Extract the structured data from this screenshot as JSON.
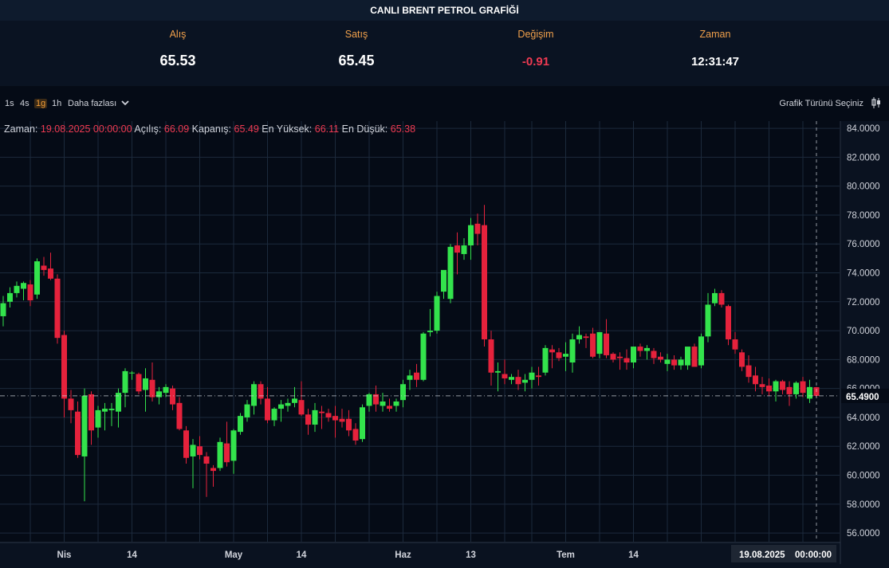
{
  "app": {
    "title": "CANLI BRENT PETROL GRAFİĞİ"
  },
  "quotes": {
    "bid_label": "Alış",
    "bid_value": "65.53",
    "ask_label": "Satış",
    "ask_value": "65.45",
    "change_label": "Değişim",
    "change_value": "-0.91",
    "time_label": "Zaman",
    "time_value": "12:31:47"
  },
  "toolbar": {
    "timeframes": [
      "1s",
      "4s",
      "1g",
      "1h"
    ],
    "active_timeframe": "1g",
    "more_label": "Daha fazlası",
    "chart_type_label": "Grafik Türünü Seçiniz"
  },
  "ohlc_legend": {
    "time_label": "Zaman:",
    "time_value": "19.08.2025 00:00:00",
    "open_label": "Açılış:",
    "open_value": "66.09",
    "close_label": "Kapanış:",
    "close_value": "65.49",
    "high_label": "En Yüksek:",
    "high_value": "66.11",
    "low_label": "En Düşük:",
    "low_value": "65.38"
  },
  "colors": {
    "up": "#33e34c",
    "down": "#e5223c",
    "accent": "#f29d38",
    "background": "#0a1220",
    "grid": "#1c2a3c"
  },
  "chart_data": {
    "type": "candlestick",
    "x_axis_labels": [
      "Nis",
      "14",
      "May",
      "14",
      "Haz",
      "13",
      "Tem",
      "14"
    ],
    "y_ticks": [
      "84.0000",
      "82.0000",
      "80.0000",
      "78.0000",
      "76.0000",
      "74.0000",
      "72.0000",
      "70.0000",
      "68.0000",
      "66.0000",
      "64.0000",
      "62.0000",
      "60.0000",
      "58.0000",
      "56.0000"
    ],
    "ylim": [
      55.4,
      84.5
    ],
    "last_price_label": "65.4900",
    "last_price": 65.49,
    "crosshair_date_label": "19.08.2025",
    "crosshair_time_label": "00:00:00",
    "grid": true,
    "candles": [
      [
        71.0,
        72.4,
        70.3,
        71.9
      ],
      [
        72.0,
        73.0,
        71.6,
        72.6
      ],
      [
        72.6,
        73.4,
        72.3,
        73.1
      ],
      [
        72.9,
        73.4,
        72.1,
        73.3
      ],
      [
        73.2,
        73.5,
        71.7,
        72.1
      ],
      [
        72.5,
        75.0,
        72.2,
        74.8
      ],
      [
        74.5,
        75.1,
        73.8,
        74.2
      ],
      [
        74.3,
        75.4,
        73.5,
        73.6
      ],
      [
        73.6,
        73.9,
        69.1,
        69.5
      ],
      [
        69.7,
        70.0,
        64.0,
        65.3
      ],
      [
        65.3,
        65.9,
        63.6,
        64.5
      ],
      [
        64.4,
        65.1,
        61.2,
        61.4
      ],
      [
        61.3,
        66.0,
        58.2,
        65.5
      ],
      [
        65.6,
        65.8,
        62.1,
        63.1
      ],
      [
        63.3,
        64.8,
        62.6,
        64.5
      ],
      [
        64.4,
        65.0,
        63.1,
        64.6
      ],
      [
        64.5,
        65.0,
        63.4,
        64.6
      ],
      [
        64.4,
        66.0,
        63.3,
        65.7
      ],
      [
        65.7,
        67.4,
        64.7,
        67.2
      ],
      [
        67.1,
        67.2,
        66.6,
        67.1
      ],
      [
        67.0,
        67.1,
        65.6,
        65.8
      ],
      [
        65.9,
        67.4,
        64.4,
        66.7
      ],
      [
        66.6,
        67.8,
        65.1,
        65.4
      ],
      [
        65.4,
        66.1,
        64.9,
        65.8
      ],
      [
        65.7,
        66.3,
        65.4,
        66.1
      ],
      [
        66.0,
        66.2,
        64.5,
        64.9
      ],
      [
        65.0,
        65.4,
        63.1,
        63.2
      ],
      [
        63.1,
        63.4,
        60.8,
        61.2
      ],
      [
        61.3,
        62.5,
        59.1,
        62.1
      ],
      [
        62.0,
        62.7,
        61.1,
        61.4
      ],
      [
        61.3,
        61.6,
        58.5,
        60.8
      ],
      [
        60.5,
        60.7,
        59.2,
        60.3
      ],
      [
        60.5,
        62.6,
        60.3,
        62.3
      ],
      [
        62.2,
        63.7,
        60.6,
        60.9
      ],
      [
        61.0,
        63.2,
        60.1,
        63.1
      ],
      [
        63.0,
        64.3,
        62.8,
        64.1
      ],
      [
        64.0,
        65.2,
        63.7,
        64.9
      ],
      [
        64.8,
        66.5,
        64.2,
        66.3
      ],
      [
        66.3,
        66.5,
        64.9,
        65.3
      ],
      [
        65.3,
        66.1,
        63.6,
        63.8
      ],
      [
        63.8,
        64.7,
        63.4,
        64.6
      ],
      [
        64.6,
        65.2,
        63.7,
        64.9
      ],
      [
        64.8,
        65.3,
        64.4,
        65.0
      ],
      [
        65.0,
        66.1,
        64.7,
        65.3
      ],
      [
        65.2,
        66.5,
        64.1,
        64.2
      ],
      [
        64.2,
        64.6,
        62.8,
        63.5
      ],
      [
        63.5,
        65.0,
        63.0,
        64.5
      ],
      [
        64.4,
        64.8,
        63.2,
        64.3
      ],
      [
        64.3,
        64.6,
        63.7,
        64.0
      ],
      [
        64.1,
        64.8,
        62.6,
        63.8
      ],
      [
        63.9,
        64.6,
        63.3,
        63.7
      ],
      [
        63.9,
        64.5,
        62.7,
        63.1
      ],
      [
        63.2,
        63.6,
        62.1,
        62.4
      ],
      [
        62.5,
        64.9,
        62.3,
        64.7
      ],
      [
        64.8,
        65.7,
        64.4,
        65.6
      ],
      [
        65.6,
        66.2,
        64.4,
        64.9
      ],
      [
        64.8,
        65.7,
        64.4,
        65.1
      ],
      [
        64.8,
        65.3,
        64.4,
        64.6
      ],
      [
        64.8,
        65.3,
        64.4,
        65.1
      ],
      [
        65.2,
        66.6,
        64.7,
        66.3
      ],
      [
        66.6,
        67.3,
        65.9,
        66.9
      ],
      [
        67.1,
        67.7,
        66.1,
        66.6
      ],
      [
        66.6,
        69.9,
        66.5,
        69.8
      ],
      [
        69.9,
        71.5,
        69.6,
        70.0
      ],
      [
        70.0,
        72.7,
        69.8,
        72.4
      ],
      [
        72.7,
        73.9,
        72.2,
        74.2
      ],
      [
        72.2,
        76.0,
        71.9,
        75.8
      ],
      [
        75.9,
        76.8,
        73.9,
        75.4
      ],
      [
        75.3,
        76.4,
        74.9,
        75.9
      ],
      [
        75.9,
        77.8,
        74.9,
        77.3
      ],
      [
        77.4,
        78.1,
        75.9,
        76.7
      ],
      [
        77.3,
        78.7,
        68.9,
        69.4
      ],
      [
        69.4,
        70.0,
        66.2,
        67.1
      ],
      [
        67.1,
        67.8,
        65.8,
        67.2
      ],
      [
        67.0,
        68.0,
        66.3,
        66.7
      ],
      [
        66.6,
        67.0,
        66.3,
        66.8
      ],
      [
        66.8,
        67.3,
        65.9,
        66.3
      ],
      [
        66.4,
        67.0,
        65.8,
        66.6
      ],
      [
        66.6,
        67.5,
        66.0,
        67.1
      ],
      [
        66.9,
        67.5,
        66.2,
        66.8
      ],
      [
        67.1,
        69.0,
        66.9,
        68.8
      ],
      [
        68.7,
        69.0,
        67.4,
        68.5
      ],
      [
        68.5,
        68.8,
        67.9,
        68.1
      ],
      [
        68.2,
        69.2,
        67.2,
        68.4
      ],
      [
        67.8,
        69.8,
        67.1,
        69.4
      ],
      [
        69.4,
        70.3,
        69.1,
        69.7
      ],
      [
        69.6,
        69.8,
        68.8,
        69.5
      ],
      [
        69.8,
        70.2,
        68.1,
        68.2
      ],
      [
        68.4,
        69.8,
        68.1,
        69.9
      ],
      [
        69.8,
        70.8,
        68.1,
        68.3
      ],
      [
        68.4,
        68.5,
        67.8,
        68.0
      ],
      [
        68.2,
        68.5,
        67.3,
        68.1
      ],
      [
        68.1,
        68.7,
        67.3,
        67.8
      ],
      [
        67.8,
        68.9,
        67.4,
        68.9
      ],
      [
        68.9,
        69.1,
        68.2,
        68.6
      ],
      [
        68.6,
        69.0,
        68.0,
        68.8
      ],
      [
        68.6,
        68.8,
        67.7,
        68.1
      ],
      [
        68.2,
        68.5,
        67.8,
        68.0
      ],
      [
        67.7,
        68.4,
        67.2,
        68.0
      ],
      [
        68.0,
        68.3,
        67.3,
        67.6
      ],
      [
        67.6,
        68.2,
        67.3,
        68.0
      ],
      [
        67.6,
        68.6,
        67.3,
        68.9
      ],
      [
        68.9,
        69.1,
        68.0,
        67.5
      ],
      [
        67.6,
        69.8,
        67.4,
        69.6
      ],
      [
        69.6,
        72.6,
        69.2,
        71.8
      ],
      [
        71.9,
        72.9,
        71.7,
        72.6
      ],
      [
        72.6,
        72.8,
        71.6,
        71.8
      ],
      [
        71.7,
        71.8,
        69.0,
        69.4
      ],
      [
        69.4,
        69.9,
        68.4,
        68.7
      ],
      [
        68.5,
        68.7,
        67.2,
        67.5
      ],
      [
        67.6,
        68.3,
        66.4,
        66.8
      ],
      [
        66.9,
        67.5,
        65.8,
        66.3
      ],
      [
        66.3,
        66.8,
        65.6,
        66.1
      ],
      [
        66.2,
        66.7,
        65.5,
        65.8
      ],
      [
        65.8,
        66.6,
        65.1,
        66.5
      ],
      [
        66.5,
        66.6,
        65.6,
        65.9
      ],
      [
        66.1,
        66.5,
        64.8,
        65.6
      ],
      [
        65.6,
        66.5,
        65.3,
        66.4
      ],
      [
        66.5,
        66.8,
        65.4,
        65.7
      ],
      [
        65.3,
        66.6,
        65.0,
        66.1
      ],
      [
        66.09,
        66.11,
        65.38,
        65.49
      ]
    ]
  }
}
